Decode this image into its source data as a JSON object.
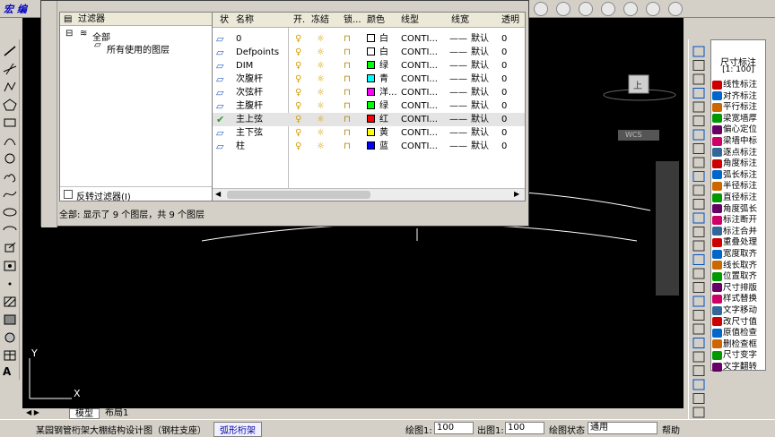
{
  "topbar": {
    "logo": "宏 编"
  },
  "dialog": {
    "tree_header": "过滤器",
    "tree_collapse": "«",
    "tree_all": "全部",
    "tree_used": "所有使用的图层",
    "invert_filter": "反转过滤器(I)",
    "status": "全部: 显示了 9 个图层，共 9 个图层",
    "columns": [
      "状",
      "名称",
      "开.",
      "冻结",
      "锁...",
      "颜色",
      "线型",
      "线宽",
      "透明"
    ],
    "layers": [
      {
        "name": "0",
        "color_name": "白",
        "color": "#ffffff",
        "linetype": "CONTI...",
        "lineweight": "默认",
        "transparency": "0"
      },
      {
        "name": "Defpoints",
        "color_name": "白",
        "color": "#ffffff",
        "linetype": "CONTI...",
        "lineweight": "默认",
        "transparency": "0"
      },
      {
        "name": "DIM",
        "color_name": "绿",
        "color": "#00ff00",
        "linetype": "CONTI...",
        "lineweight": "默认",
        "transparency": "0"
      },
      {
        "name": "次腹杆",
        "color_name": "青",
        "color": "#00ffff",
        "linetype": "CONTI...",
        "lineweight": "默认",
        "transparency": "0"
      },
      {
        "name": "次弦杆",
        "color_name": "洋...",
        "color": "#ff00ff",
        "linetype": "CONTI...",
        "lineweight": "默认",
        "transparency": "0"
      },
      {
        "name": "主腹杆",
        "color_name": "绿",
        "color": "#00ff00",
        "linetype": "CONTI...",
        "lineweight": "默认",
        "transparency": "0"
      },
      {
        "name": "主上弦",
        "color_name": "红",
        "color": "#ff0000",
        "linetype": "CONTI...",
        "lineweight": "默认",
        "transparency": "0"
      },
      {
        "name": "主下弦",
        "color_name": "黄",
        "color": "#ffff00",
        "linetype": "CONTI...",
        "lineweight": "默认",
        "transparency": "0"
      },
      {
        "name": "柱",
        "color_name": "蓝",
        "color": "#0000ff",
        "linetype": "CONTI...",
        "lineweight": "默认",
        "transparency": "0"
      }
    ]
  },
  "canvas": {
    "axis_y": "Y",
    "axis_x": "X",
    "viewcube": "上",
    "wcs": "WCS"
  },
  "right_panel": {
    "title": "尺寸标注",
    "scale": "[1: 100]",
    "items": [
      "线性标注",
      "对齐标注",
      "平行标注",
      "梁宽墙厚",
      "偏心定位",
      "梁墙中标",
      "逐点标注",
      "角度标注",
      "弧长标注",
      "半径标注",
      "直径标注",
      "角度弧长",
      "标注断开",
      "标注合并",
      "重叠处理",
      "宽度取齐",
      "线长取齐",
      "位置取齐",
      "尺寸排版",
      "样式替换",
      "文字移动",
      "改尺寸值",
      "原值检查",
      "删检查框",
      "尺寸变字",
      "文字翻转"
    ]
  },
  "tabs": {
    "model": "模型",
    "layout1": "布局1"
  },
  "bottom": {
    "project": "某园钢管桁架大棚结构设计图（钢柱支座）",
    "active_tab": "弧形桁架",
    "draw_scale_label": "绘图1:",
    "draw_scale": "100",
    "out_scale_label": "出图1:",
    "out_scale": "100",
    "draw_state_label": "绘图状态",
    "draw_state": "通用",
    "help": "帮助"
  }
}
